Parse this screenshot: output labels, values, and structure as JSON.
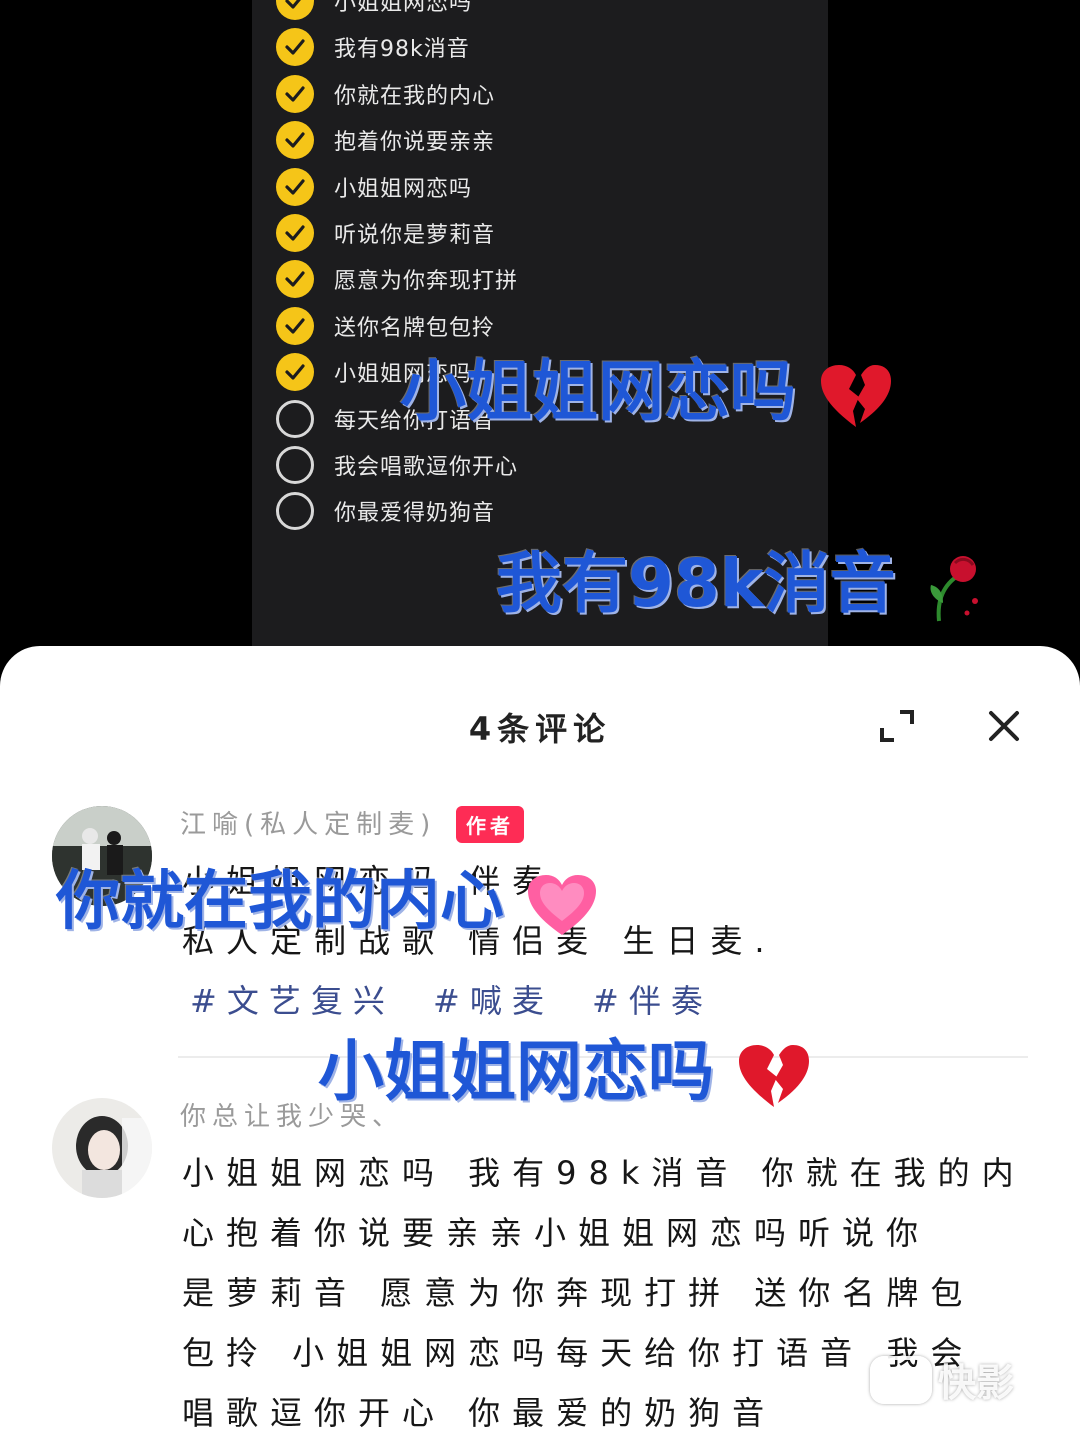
{
  "checklist": {
    "items": [
      {
        "label": "小姐姐网恋吗",
        "done": true
      },
      {
        "label": "我有98k消音",
        "done": true
      },
      {
        "label": "你就在我的内心",
        "done": true
      },
      {
        "label": "抱着你说要亲亲",
        "done": true
      },
      {
        "label": "小姐姐网恋吗",
        "done": true
      },
      {
        "label": "听说你是萝莉音",
        "done": true
      },
      {
        "label": "愿意为你奔现打拼",
        "done": true
      },
      {
        "label": "送你名牌包包拎",
        "done": true
      },
      {
        "label": "小姐姐网恋吗",
        "done": true
      },
      {
        "label": "每天给你打语音",
        "done": false
      },
      {
        "label": "我会唱歌逗你开心",
        "done": false
      },
      {
        "label": "你最爱得奶狗音",
        "done": false
      }
    ]
  },
  "overlays": {
    "line1": "小姐姐网恋吗",
    "line2": "我有98k消音",
    "line3": "你就在我的内心",
    "line4": "小姐姐网恋吗"
  },
  "comments_sheet": {
    "title": "4条评论",
    "comments": [
      {
        "name": "江喻(私人定制麦)",
        "badge": "作者",
        "lines": [
          "小姐姐网恋吗 伴奏",
          "私人定制战歌 情侣麦 生日麦."
        ],
        "hashtags": [
          "#文艺复兴",
          "#喊麦",
          "#伴奏"
        ]
      },
      {
        "name": "你总让我少哭、",
        "lines": [
          "小姐姐网恋吗 我有98k消音 你就在我的内",
          "心抱着你说要亲亲小姐姐网恋吗听说你",
          "是萝莉音 愿意为你奔现打拼 送你名牌包",
          "包拎 小姐姐网恋吗每天给你打语音 我会",
          "唱歌逗你开心 你最爱的奶狗音"
        ]
      }
    ]
  },
  "watermark": {
    "label": "快影"
  },
  "colors": {
    "check_yellow": "#f5c518",
    "overlay_blue": "#1f57d6",
    "badge_red": "#fe2c55"
  }
}
